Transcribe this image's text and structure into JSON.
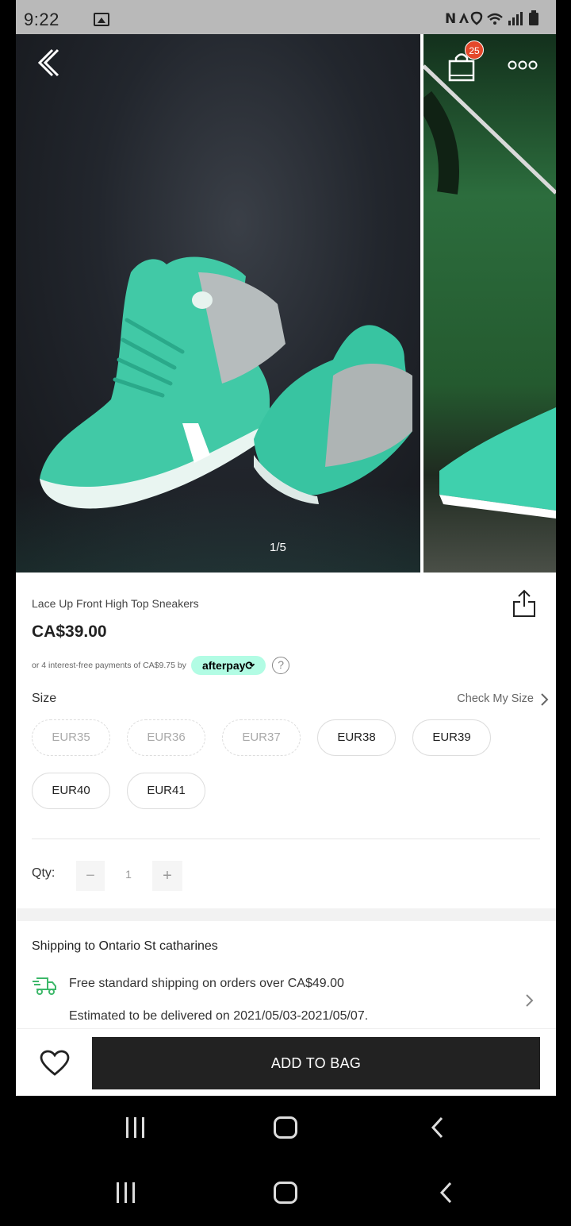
{
  "status_bar": {
    "time": "9:22",
    "right_icons": "NFC, location, wifi, signal, battery"
  },
  "gallery": {
    "counter": "1/5",
    "cart_badge": "25"
  },
  "product": {
    "title": "Lace Up Front High Top Sneakers",
    "price": "CA$39.00",
    "afterpay_text": "or 4 interest-free payments of CA$9.75 by",
    "afterpay_brand": "afterpay",
    "help_symbol": "?"
  },
  "size": {
    "label": "Size",
    "check_my_size": "Check My Size",
    "options": [
      {
        "label": "EUR35",
        "available": false
      },
      {
        "label": "EUR36",
        "available": false
      },
      {
        "label": "EUR37",
        "available": false
      },
      {
        "label": "EUR38",
        "available": true
      },
      {
        "label": "EUR39",
        "available": true
      },
      {
        "label": "EUR40",
        "available": true
      },
      {
        "label": "EUR41",
        "available": true
      }
    ]
  },
  "quantity": {
    "label": "Qty:",
    "minus": "−",
    "value": "1",
    "plus": "+"
  },
  "shipping": {
    "title": "Shipping to Ontario St catharines",
    "free_shipping": "Free standard shipping on orders over CA$49.00",
    "estimate": "Estimated to be delivered on 2021/05/03-2021/05/07."
  },
  "actions": {
    "add_to_bag": "ADD TO BAG"
  },
  "icons": {
    "back": "back-icon",
    "cart": "shopping-bag-icon",
    "more": "more-icon",
    "share": "share-icon",
    "help": "help-icon",
    "chevron": "chevron-right-icon",
    "truck": "truck-icon",
    "wishlist": "heart-icon"
  },
  "colors": {
    "accent_badge": "#e4482b",
    "afterpay": "#b2fce4",
    "button": "#222222",
    "shoe": "#3fc9a8"
  }
}
